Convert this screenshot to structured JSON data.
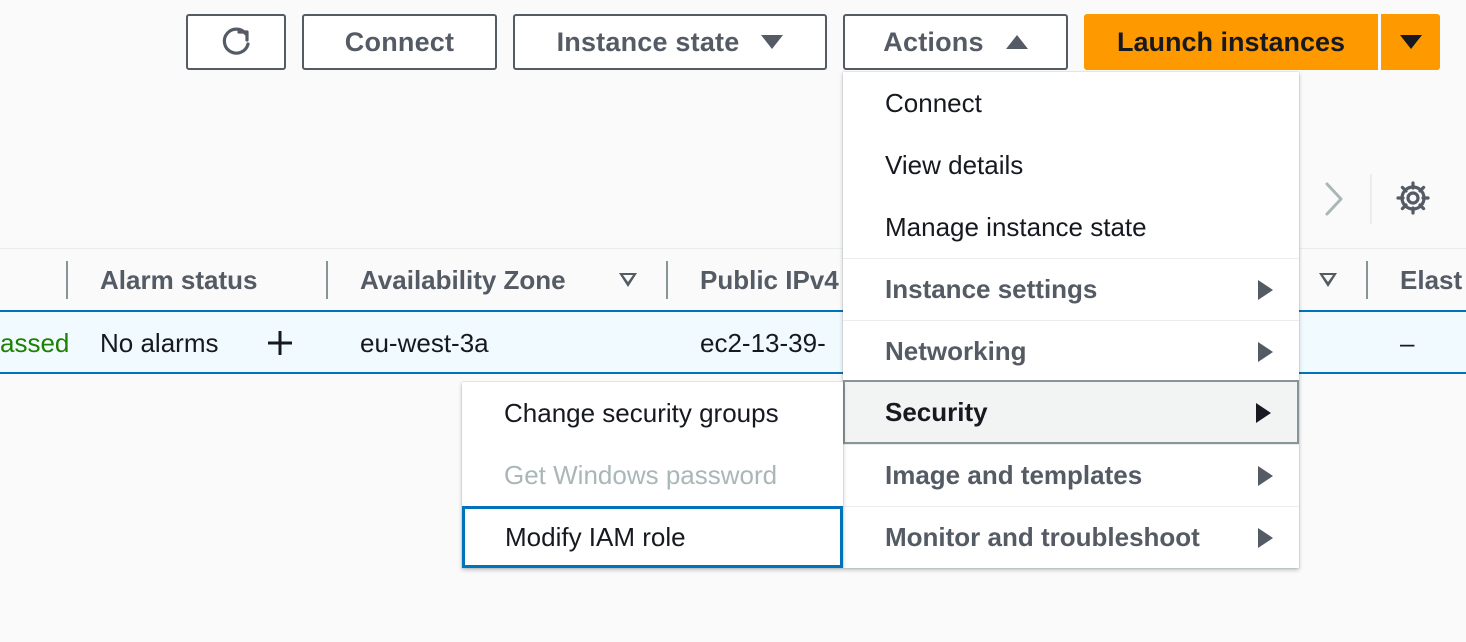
{
  "toolbar": {
    "connect_label": "Connect",
    "instance_state_label": "Instance state",
    "actions_label": "Actions",
    "launch_label": "Launch instances"
  },
  "table": {
    "columns": [
      "Alarm status",
      "Availability Zone",
      "Public IPv4",
      "Elast"
    ],
    "row": {
      "status_check": "assed",
      "alarm_status": "No alarms",
      "availability_zone": "eu-west-3a",
      "public_ipv4": "ec2-13-39-",
      "elastic_ip": "–"
    }
  },
  "actions_menu": {
    "items": [
      {
        "label": "Connect"
      },
      {
        "label": "View details"
      },
      {
        "label": "Manage instance state"
      },
      {
        "label": "Instance settings"
      },
      {
        "label": "Networking"
      },
      {
        "label": "Security"
      },
      {
        "label": "Image and templates"
      },
      {
        "label": "Monitor and troubleshoot"
      }
    ]
  },
  "security_submenu": {
    "items": [
      {
        "label": "Change security groups",
        "disabled": false
      },
      {
        "label": "Get Windows password",
        "disabled": true
      },
      {
        "label": "Modify IAM role",
        "disabled": false
      }
    ]
  },
  "colors": {
    "accent": "#ff9900",
    "selection_border": "#0073bb",
    "passed_text": "#1d8102",
    "disabled_text": "#aab7b8"
  },
  "icons": [
    "refresh-icon",
    "chevron-right-icon",
    "gear-icon",
    "plus-icon",
    "caret-down-icon",
    "caret-up-icon",
    "caret-right-icon"
  ]
}
